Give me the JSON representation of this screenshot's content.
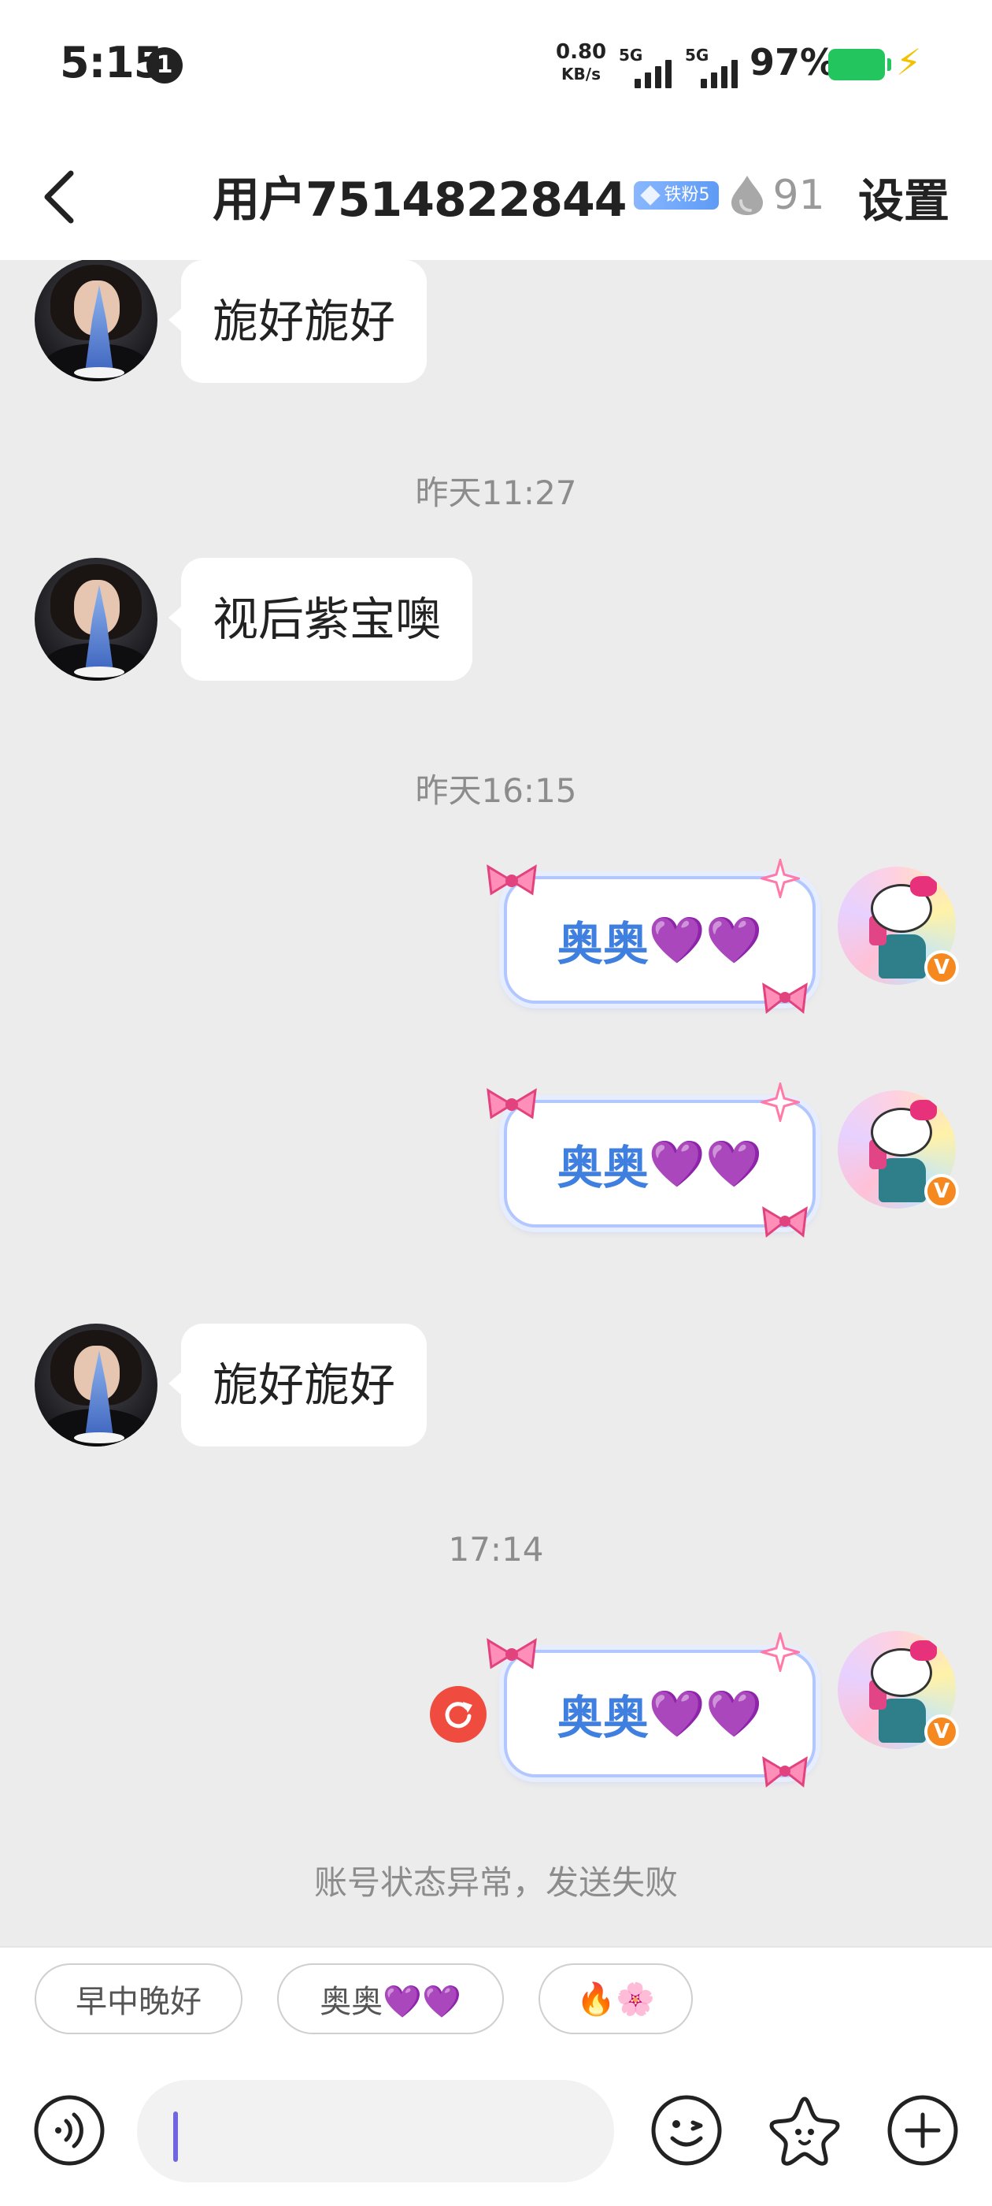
{
  "status_bar": {
    "time": "5:15",
    "notification_count": "1",
    "net_speed": "0.80",
    "net_speed_unit": "KB/s",
    "signal1_label": "5G",
    "signal2_label": "5G",
    "battery": "97%"
  },
  "header": {
    "title": "用户7514822844",
    "fan_badge": "铁粉5",
    "intimacy": "91",
    "settings_label": "设置"
  },
  "messages": {
    "m1_text": "旎好旎好",
    "ts1": "昨天11:27",
    "m2_text": "视后紫宝噢",
    "ts2": "昨天16:15",
    "m3_text": "奥奥",
    "m3_hearts": "💜💜",
    "m4_text": "奥奥",
    "m4_hearts": "💜💜",
    "m5_text": "旎好旎好",
    "ts3": "17:14",
    "m6_text": "奥奥",
    "m6_hearts": "💜💜",
    "error": "账号状态异常，发送失败"
  },
  "quick_replies": [
    "早中晚好",
    "奥奥💜💜",
    "🔥🌸"
  ],
  "input": {
    "value": "",
    "placeholder": ""
  },
  "icons": {
    "back": "chevron-left-icon",
    "voice": "voice-icon",
    "emoji": "emoji-icon",
    "sticker": "star-sticker-icon",
    "add": "plus-icon",
    "retry": "retry-icon"
  },
  "colors": {
    "chat_bg": "#ececec",
    "bubble_text_right": "#3f7fe0",
    "retry_red": "#ef4b3f",
    "battery_green": "#22c55e",
    "vip_orange": "#f5881f"
  }
}
